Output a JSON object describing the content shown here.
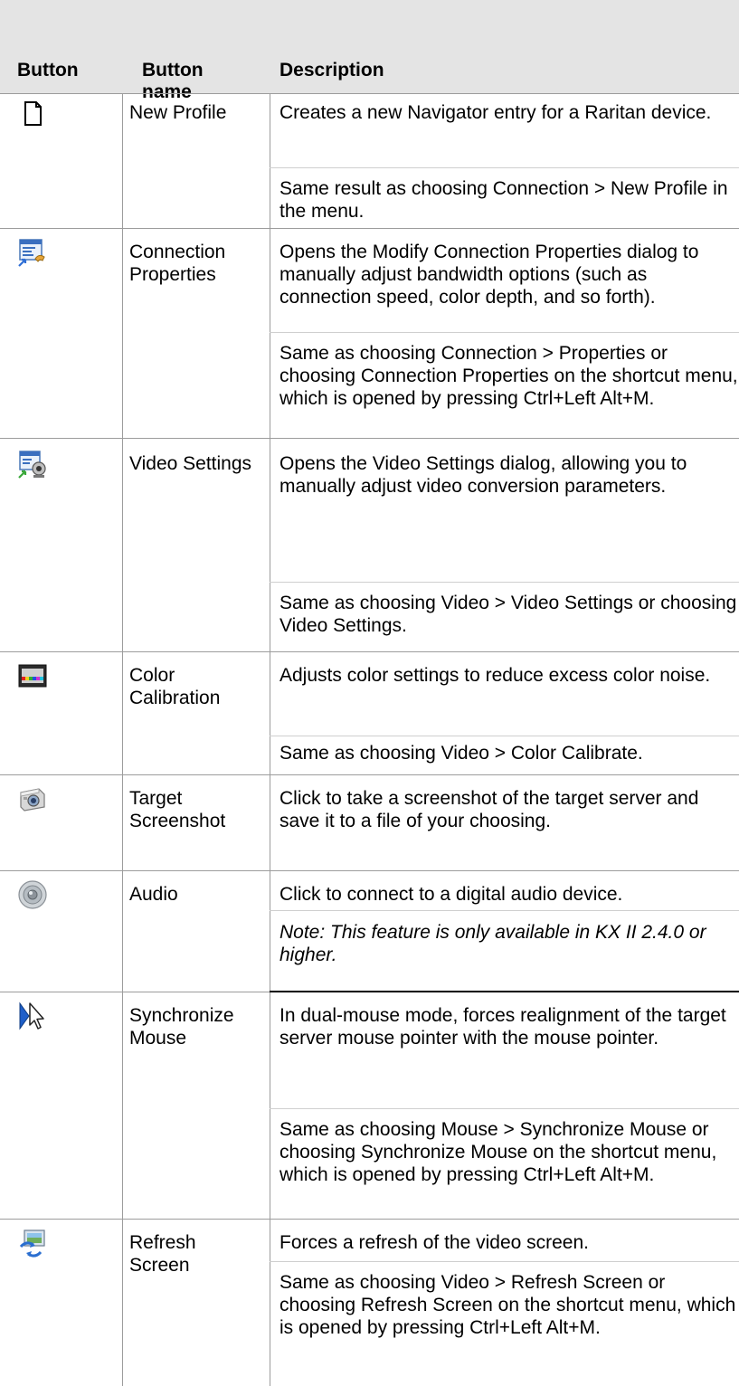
{
  "header": {
    "button": "Button",
    "button_name": "Button\nname",
    "description": "Description"
  },
  "rows": [
    {
      "icon": "new-profile-icon",
      "name": "New Profile",
      "desc": [
        "Creates a new Navigator entry for a Raritan device.",
        "Same result as choosing Connection > New Profile in the menu."
      ]
    },
    {
      "icon": "connection-properties-icon",
      "name": "Connection Properties",
      "desc": [
        "Opens the Modify Connection Properties dialog to manually adjust bandwidth options (such as connection speed, color depth, and so forth).",
        "Same as choosing Connection > Properties or choosing Connection Properties on the shortcut menu, which is opened by pressing Ctrl+Left Alt+M."
      ]
    },
    {
      "icon": "video-settings-icon",
      "name": "Video Settings",
      "desc": [
        "Opens the Video Settings dialog, allowing you to manually adjust video conversion parameters.",
        "Same as choosing Video > Video Settings or choosing Video Settings."
      ]
    },
    {
      "icon": "color-calibration-icon",
      "name": "Color Calibration",
      "desc": [
        "Adjusts color settings to reduce excess color noise.",
        "Same as choosing Video > Color Calibrate."
      ]
    },
    {
      "icon": "camera-icon",
      "name": "Target Screenshot",
      "desc": [
        "Click to take a screenshot of the target server and save it to a file of your choosing."
      ]
    },
    {
      "icon": "speaker-icon",
      "name": "Audio",
      "desc": [
        "Click to connect to a digital audio device.",
        "Note: This feature is only available in KX II 2.4.0 or higher."
      ]
    },
    {
      "icon": "mouse-pointer-icon",
      "name": "Synchronize Mouse",
      "desc": [
        "In dual-mouse mode, forces realignment of the target server mouse pointer with the mouse pointer.",
        "Same as choosing Mouse > Synchronize Mouse or choosing Synchronize Mouse on the shortcut menu, which is opened by pressing Ctrl+Left Alt+M."
      ]
    },
    {
      "icon": "refresh-screen-icon",
      "name": "Refresh Screen",
      "desc": [
        "Forces a refresh of the video screen.",
        "Same as choosing Video > Refresh Screen or choosing Refresh Screen on the shortcut menu, which is opened by pressing Ctrl+Left Alt+M."
      ]
    }
  ]
}
